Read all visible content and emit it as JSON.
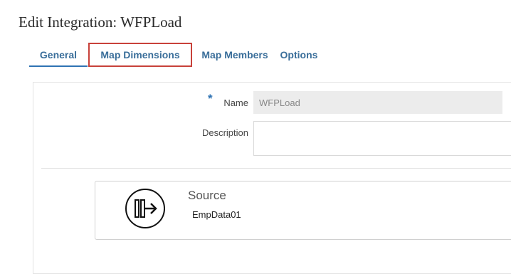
{
  "page": {
    "title": "Edit Integration: WFPLoad"
  },
  "tabs": [
    {
      "label": "General",
      "active": true
    },
    {
      "label": "Map Dimensions",
      "highlighted": true
    },
    {
      "label": "Map Members"
    },
    {
      "label": "Options"
    }
  ],
  "form": {
    "required_mark": "*",
    "name_label": "Name",
    "name_value": "WFPLoad",
    "description_label": "Description",
    "description_value": ""
  },
  "source": {
    "title": "Source",
    "value": "EmpData01",
    "icon": "source-connector-icon"
  },
  "colors": {
    "accent": "#2f73b3",
    "tab_text": "#3a6e9a",
    "highlight_border": "#c8413a"
  }
}
